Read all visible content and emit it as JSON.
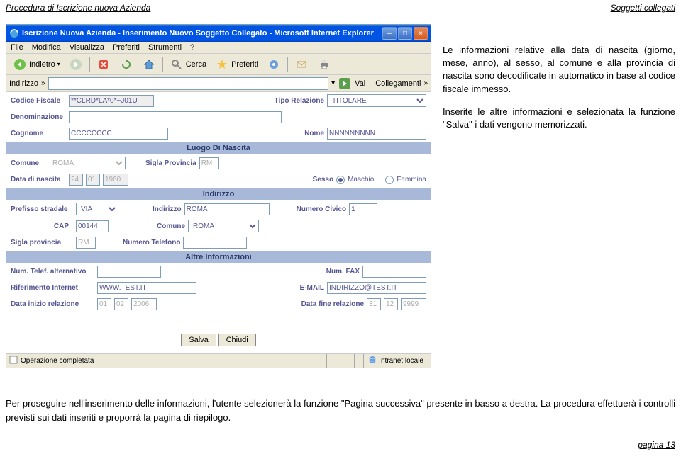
{
  "doc": {
    "header_left": "Procedura di Iscrizione nuova Azienda",
    "header_right": "Soggetti collegati",
    "footer": "pagina 13"
  },
  "side": {
    "p1": "Le informazioni relative alla data di nascita (giorno, mese, anno), al sesso, al comune e alla provincia di nascita sono decodificate in automatico in base al codice fiscale immesso.",
    "p2": "Inserite le altre informazioni e selezionata la funzione \"Salva\" i dati vengono memorizzati."
  },
  "lower": "Per proseguire nell'inserimento delle informazioni, l'utente selezionerà la funzione \"Pagina successiva\" presente in basso a destra. La procedura effettuerà i controlli previsti sui dati inseriti e proporrà la pagina di riepilogo.",
  "window": {
    "title": "Iscrizione Nuova Azienda - Inserimento Nuovo Soggetto Collegato - Microsoft Internet Explorer"
  },
  "menu": {
    "file": "File",
    "modifica": "Modifica",
    "visualizza": "Visualizza",
    "preferiti": "Preferiti",
    "strumenti": "Strumenti",
    "help": "?"
  },
  "toolbar": {
    "indietro": "Indietro",
    "cerca": "Cerca",
    "preferiti": "Preferiti"
  },
  "addr": {
    "label": "Indirizzo",
    "vai": "Vai",
    "collegamenti": "Collegamenti"
  },
  "form": {
    "codice_fiscale_lbl": "Codice Fiscale",
    "codice_fiscale": "**CLRD*LA*0*~J01U",
    "tipo_relazione_lbl": "Tipo Relazione",
    "tipo_relazione": "TITOLARE",
    "denominazione_lbl": "Denominazione",
    "cognome_lbl": "Cognome",
    "cognome": "CCCCCCCC",
    "nome_lbl": "Nome",
    "nome": "NNNNNNNNN",
    "luogo_hdr": "Luogo Di Nascita",
    "comune_lbl": "Comune",
    "comune": "ROMA",
    "sigla_prov_lbl": "Sigla Provincia",
    "sigla_prov": "RM",
    "data_nascita_lbl": "Data di nascita",
    "dn_g": "24",
    "dn_m": "01",
    "dn_a": "1960",
    "sesso_lbl": "Sesso",
    "maschio": "Maschio",
    "femmina": "Femmina",
    "indirizzo_hdr": "Indirizzo",
    "prefisso_lbl": "Prefisso stradale",
    "prefisso": "VIA",
    "indirizzo_lbl": "Indirizzo",
    "indirizzo": "ROMA",
    "numciv_lbl": "Numero Civico",
    "numciv": "1",
    "cap_lbl": "CAP",
    "cap": "00144",
    "comune2_lbl": "Comune",
    "comune2": "ROMA",
    "sigprov2_lbl": "Sigla provincia",
    "sigprov2": "RM",
    "tel_lbl": "Numero Telefono",
    "altre_hdr": "Altre Informazioni",
    "telalt_lbl": "Num. Telef. alternativo",
    "fax_lbl": "Num. FAX",
    "rifint_lbl": "Riferimento Internet",
    "rifint": "WWW.TEST.IT",
    "email_lbl": "E-MAIL",
    "email": "INDIRIZZO@TEST.IT",
    "dinizio_lbl": "Data inizio relazione",
    "di_g": "01",
    "di_m": "02",
    "di_a": "2006",
    "dfine_lbl": "Data fine relazione",
    "df_g": "31",
    "df_m": "12",
    "df_a": "9999",
    "salva": "Salva",
    "chiudi": "Chiudi"
  },
  "status": {
    "done": "Operazione completata",
    "zone": "Intranet locale"
  }
}
